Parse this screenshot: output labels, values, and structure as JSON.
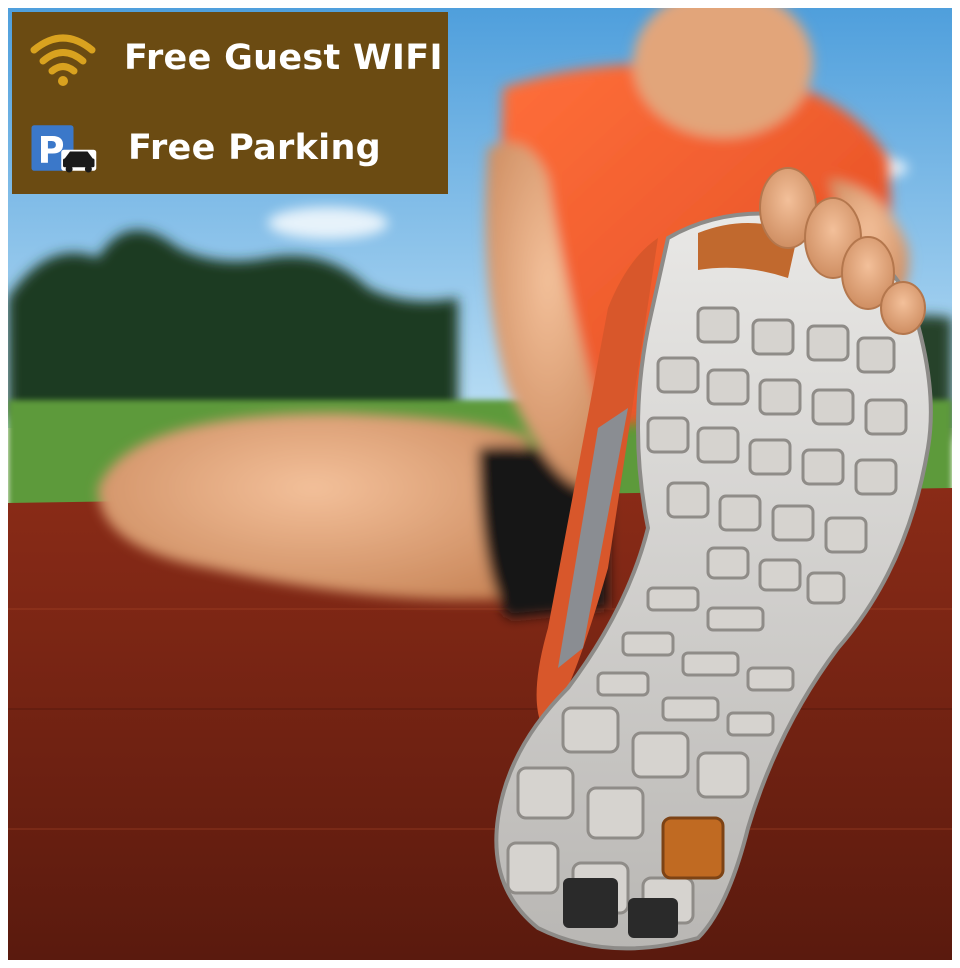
{
  "amenities": {
    "wifi": {
      "label": "Free Guest WIFI",
      "icon": "wifi-icon"
    },
    "parking": {
      "label": "Free Parking",
      "icon": "parking-car-icon"
    }
  },
  "colors": {
    "panel_background": "#6b4b12",
    "wifi_icon": "#d9a21f",
    "parking_sign": "#3b78c9",
    "label_text": "#ffffff"
  },
  "photo": {
    "subject": "runner stretching on red track showing shoe sole"
  }
}
